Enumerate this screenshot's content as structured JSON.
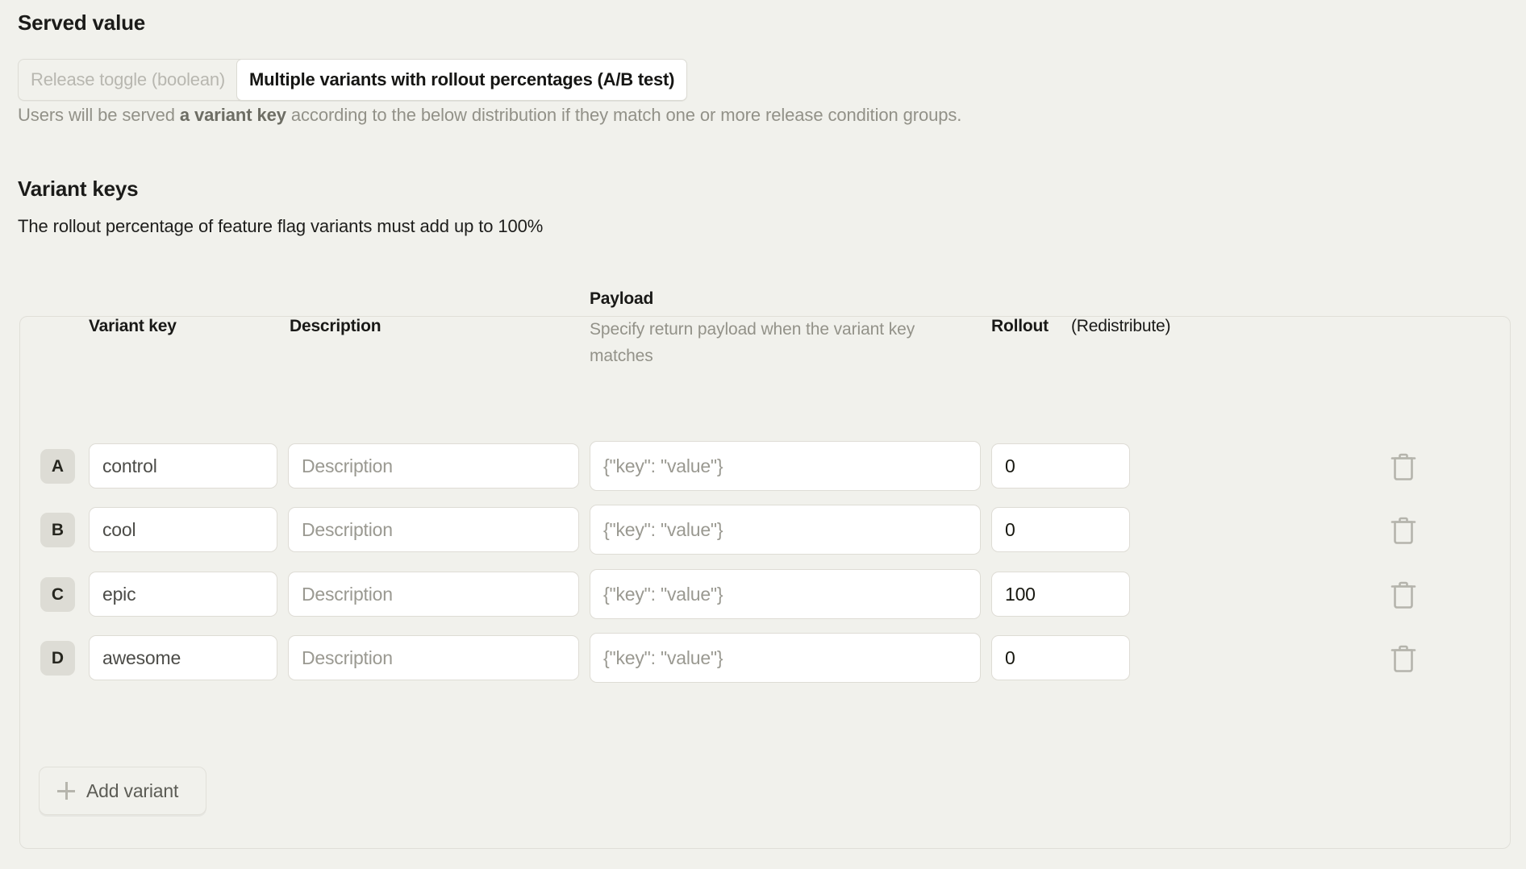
{
  "served_value": {
    "title": "Served value",
    "segments": [
      {
        "label": "Release toggle (boolean)",
        "active": false
      },
      {
        "label": "Multiple variants with rollout percentages (A/B test)",
        "active": true
      }
    ],
    "description_prefix": "Users will be served ",
    "description_strong": "a variant key",
    "description_suffix": " according to the below distribution if they match one or more release condition groups."
  },
  "variant_keys": {
    "title": "Variant keys",
    "description": "The rollout percentage of feature flag variants must add up to 100%",
    "headers": {
      "variant_key": "Variant key",
      "description": "Description",
      "payload": "Payload",
      "payload_sub": "Specify return payload when the variant key matches",
      "rollout": "Rollout",
      "redistribute": "(Redistribute)"
    },
    "placeholders": {
      "description": "Description",
      "payload": "{\"key\": \"value\"}"
    },
    "rows": [
      {
        "badge": "A",
        "key": "control",
        "description": "",
        "payload": "",
        "rollout": "0"
      },
      {
        "badge": "B",
        "key": "cool",
        "description": "",
        "payload": "",
        "rollout": "0"
      },
      {
        "badge": "C",
        "key": "epic",
        "description": "",
        "payload": "",
        "rollout": "100"
      },
      {
        "badge": "D",
        "key": "awesome",
        "description": "",
        "payload": "",
        "rollout": "0"
      }
    ],
    "add_variant_label": "Add variant",
    "delete_icon": "trash-icon"
  },
  "colors": {
    "page_background": "#f1f1ec",
    "card_border": "#e0dfd8",
    "input_background": "#ffffff",
    "input_border": "#dedcd5",
    "badge_background": "#dddcd5",
    "muted_text": "#939289",
    "body_text": "#1d1d1b"
  }
}
